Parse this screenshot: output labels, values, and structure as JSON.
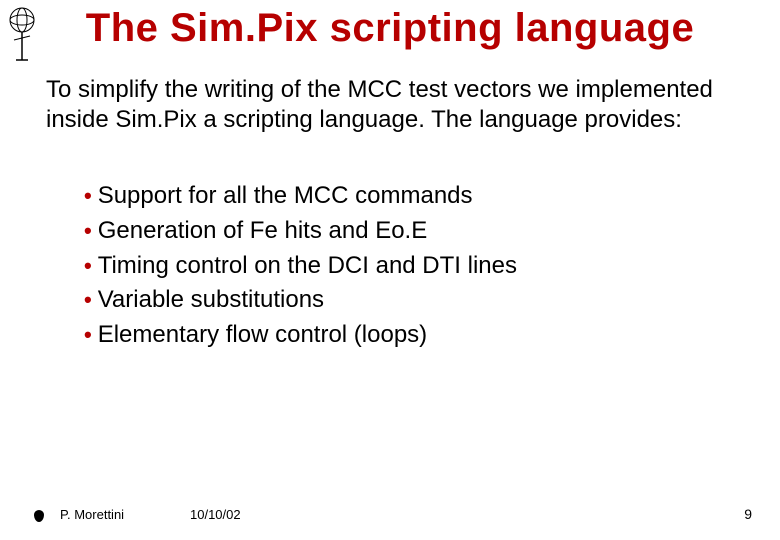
{
  "title": "The Sim.Pix scripting language",
  "intro": "To simplify the writing of the MCC test vectors we implemented inside Sim.Pix a scripting language. The language provides:",
  "bullets": [
    "Support for all the MCC commands",
    "Generation of Fe hits and Eo.E",
    "Timing control on the DCI and DTI lines",
    "Variable substitutions",
    "Elementary flow control (loops)"
  ],
  "footer": {
    "author": "P. Morettini",
    "date": "10/10/02",
    "page": "9"
  },
  "colors": {
    "accent": "#b60000"
  }
}
